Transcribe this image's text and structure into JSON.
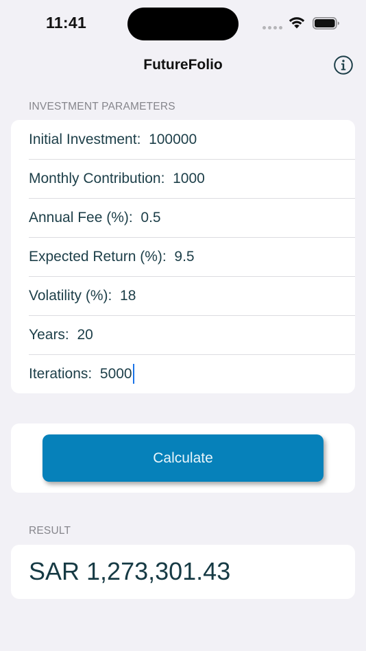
{
  "status_bar": {
    "time": "11:41"
  },
  "nav": {
    "title": "FutureFolio",
    "info_icon": "info-circle-icon"
  },
  "parameters": {
    "header": "INVESTMENT PARAMETERS",
    "fields": [
      {
        "label": "Initial Investment:  ",
        "value": "100000"
      },
      {
        "label": "Monthly Contribution:  ",
        "value": "1000"
      },
      {
        "label": "Annual Fee (%):  ",
        "value": "0.5"
      },
      {
        "label": "Expected Return (%):  ",
        "value": "9.5"
      },
      {
        "label": "Volatility (%):  ",
        "value": "18"
      },
      {
        "label": "Years:  ",
        "value": "20"
      },
      {
        "label": "Iterations:  ",
        "value": "5000"
      }
    ]
  },
  "actions": {
    "calculate_label": "Calculate"
  },
  "result": {
    "header": "RESULT",
    "value": "SAR 1,273,301.43"
  },
  "colors": {
    "accent": "#0681ba",
    "text": "#1c3e48",
    "background": "#f2f1f6",
    "caret": "#1a73e8"
  }
}
